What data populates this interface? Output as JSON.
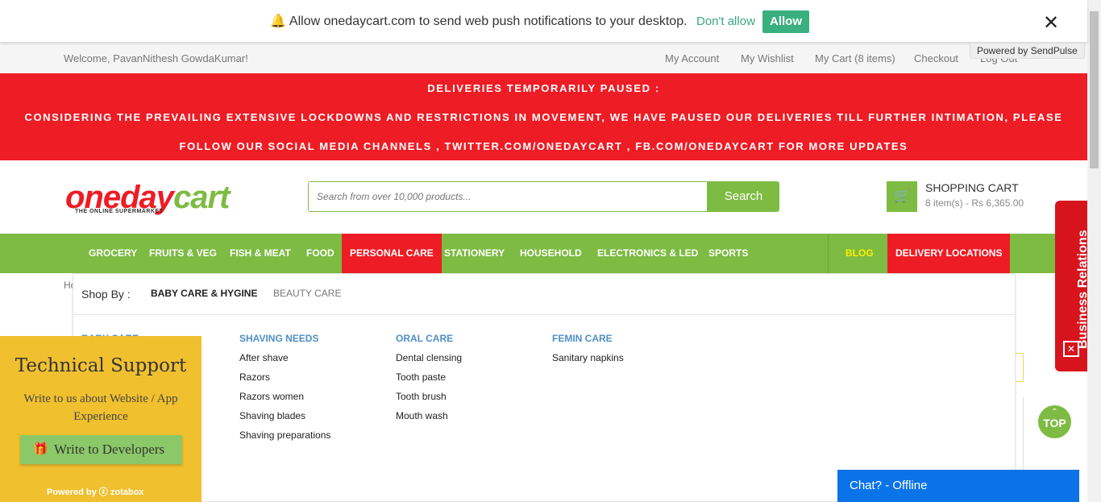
{
  "push": {
    "bell": "🔔",
    "message": "Allow onedaycart.com to send web push notifications to your desktop.",
    "dont_allow": "Don't allow",
    "allow": "Allow",
    "close": "✕",
    "powered_by": "Powered by SendPulse"
  },
  "topbar": {
    "welcome": "Welcome, PavanNithesh GowdaKumar!",
    "links": [
      "My Account",
      "My Wishlist",
      "My Cart (8 items)",
      "Checkout",
      "Log Out"
    ]
  },
  "banner": {
    "line1": "DELIVERIES TEMPORARILY PAUSED :",
    "line2": "CONSIDERING THE PREVAILING EXTENSIVE LOCKDOWNS AND RESTRICTIONS IN MOVEMENT, WE HAVE PAUSED OUR DELIVERIES TILL FURTHER INTIMATION, PLEASE",
    "line3": "FOLLOW OUR SOCIAL MEDIA CHANNELS , TWITTER.COM/ONEDAYCART , FB.COM/ONEDAYCART FOR MORE UPDATES",
    "color": "#ee1c25"
  },
  "logo": {
    "one": "one",
    "day": "day",
    "cart": "cart",
    "tagline": "THE ONLINE SUPERMARKET"
  },
  "search": {
    "placeholder": "Search from over 10,000 products...",
    "button": "Search"
  },
  "cart": {
    "icon": "shopping-cart-icon",
    "title": "SHOPPING CART",
    "summary": "8 item(s) - Rs 6,365.00"
  },
  "nav": {
    "items": [
      "GROCERY",
      "FRUITS & VEG",
      "FISH & MEAT",
      "FOOD",
      "PERSONAL CARE",
      "STATIONERY",
      "HOUSEHOLD",
      "ELECTRONICS & LED",
      "SPORTS",
      "BLOG",
      "DELIVERY LOCATIONS"
    ],
    "accent": "#7dbb42"
  },
  "breadcrumb": "Ho",
  "mega": {
    "shop_by": "Shop By :",
    "tabs": [
      "BABY CARE & HYGINE",
      "BEAUTY CARE"
    ],
    "hidden_heading": "BABY CARE",
    "columns": [
      {
        "heading": "SHAVING NEEDS",
        "items": [
          "After shave",
          "Razors",
          "Razors women",
          "Shaving blades",
          "Shaving preparations"
        ]
      },
      {
        "heading": "ORAL CARE",
        "items": [
          "Dental clensing",
          "Tooth paste",
          "Tooth brush",
          "Mouth wash"
        ]
      },
      {
        "heading": "FEMIN CARE",
        "items": [
          "Sanitary napkins"
        ]
      }
    ]
  },
  "support": {
    "title": "Technical Support",
    "description": "Write to us about Website / App Experience",
    "button": "Write to Developers",
    "powered": "Powered by ⓩ zotabox"
  },
  "business": {
    "label": "Business Relations"
  },
  "top_button": {
    "arrow": "⌃",
    "label": "TOP"
  },
  "chat": {
    "label": "Chat? - Offline"
  }
}
